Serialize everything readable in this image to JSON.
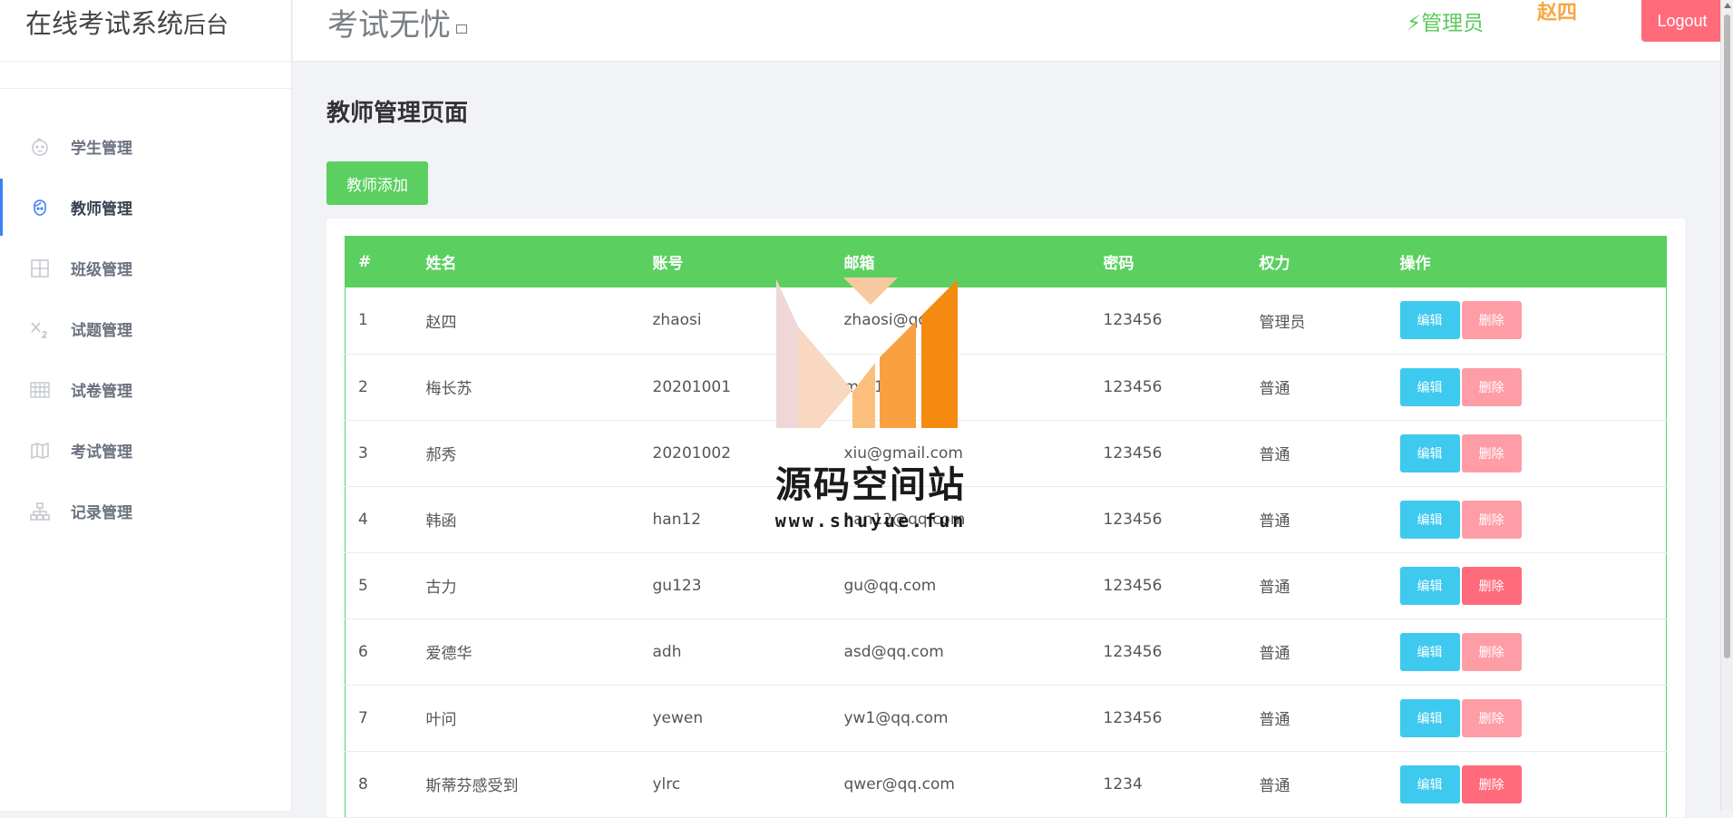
{
  "sidebar": {
    "brand_main": "在线考试系统",
    "brand_suffix": "后台",
    "items": [
      {
        "label": "学生管理",
        "icon": "baby-face-icon"
      },
      {
        "label": "教师管理",
        "icon": "teacher-face-icon"
      },
      {
        "label": "班级管理",
        "icon": "grid-icon"
      },
      {
        "label": "试题管理",
        "icon": "subscript-icon"
      },
      {
        "label": "试卷管理",
        "icon": "table-icon"
      },
      {
        "label": "考试管理",
        "icon": "map-icon"
      },
      {
        "label": "记录管理",
        "icon": "sitemap-icon"
      }
    ],
    "active_index": 1
  },
  "header": {
    "title": "考试无忧",
    "role": "⚡管理员",
    "username": "赵四",
    "logout_label": "Logout"
  },
  "main": {
    "page_title": "教师管理页面",
    "add_button": "教师添加",
    "table": {
      "columns": [
        "#",
        "姓名",
        "账号",
        "邮箱",
        "密码",
        "权力",
        "操作"
      ],
      "edit_label": "编辑",
      "delete_label": "删除",
      "rows": [
        {
          "num": "1",
          "name": "赵四",
          "account": "zhaosi",
          "email": "zhaosi@qq.c",
          "password": "123456",
          "role": "管理员",
          "delete_style": "faded"
        },
        {
          "num": "2",
          "name": "梅长苏",
          "account": "20201001",
          "email": "m@1  .co",
          "password": "123456",
          "role": "普通",
          "delete_style": "faded"
        },
        {
          "num": "3",
          "name": "郝秀",
          "account": "20201002",
          "email": "xiu@gmail.com",
          "password": "123456",
          "role": "普通",
          "delete_style": "faded"
        },
        {
          "num": "4",
          "name": "韩函",
          "account": "han12",
          "email": "han12@qq.com",
          "password": "123456",
          "role": "普通",
          "delete_style": "faded"
        },
        {
          "num": "5",
          "name": "古力",
          "account": "gu123",
          "email": "gu@qq.com",
          "password": "123456",
          "role": "普通",
          "delete_style": "solid"
        },
        {
          "num": "6",
          "name": "爱德华",
          "account": "adh",
          "email": "asd@qq.com",
          "password": "123456",
          "role": "普通",
          "delete_style": "faded"
        },
        {
          "num": "7",
          "name": "叶问",
          "account": "yewen",
          "email": "yw1@qq.com",
          "password": "123456",
          "role": "普通",
          "delete_style": "faded"
        },
        {
          "num": "8",
          "name": "斯蒂芬感受到",
          "account": "ylrc",
          "email": "qwer@qq.com",
          "password": "1234",
          "role": "普通",
          "delete_style": "solid"
        }
      ]
    }
  },
  "watermark": {
    "text": "源码空间站",
    "url": "www.shuyue.fun"
  },
  "colors": {
    "accent_green": "#5bd060",
    "edit_blue": "#3ec9ef",
    "delete_red": "#ff6b7a",
    "delete_faded": "#ff9da6",
    "username_orange": "#f7a640",
    "active_nav": "#3b82f6"
  }
}
